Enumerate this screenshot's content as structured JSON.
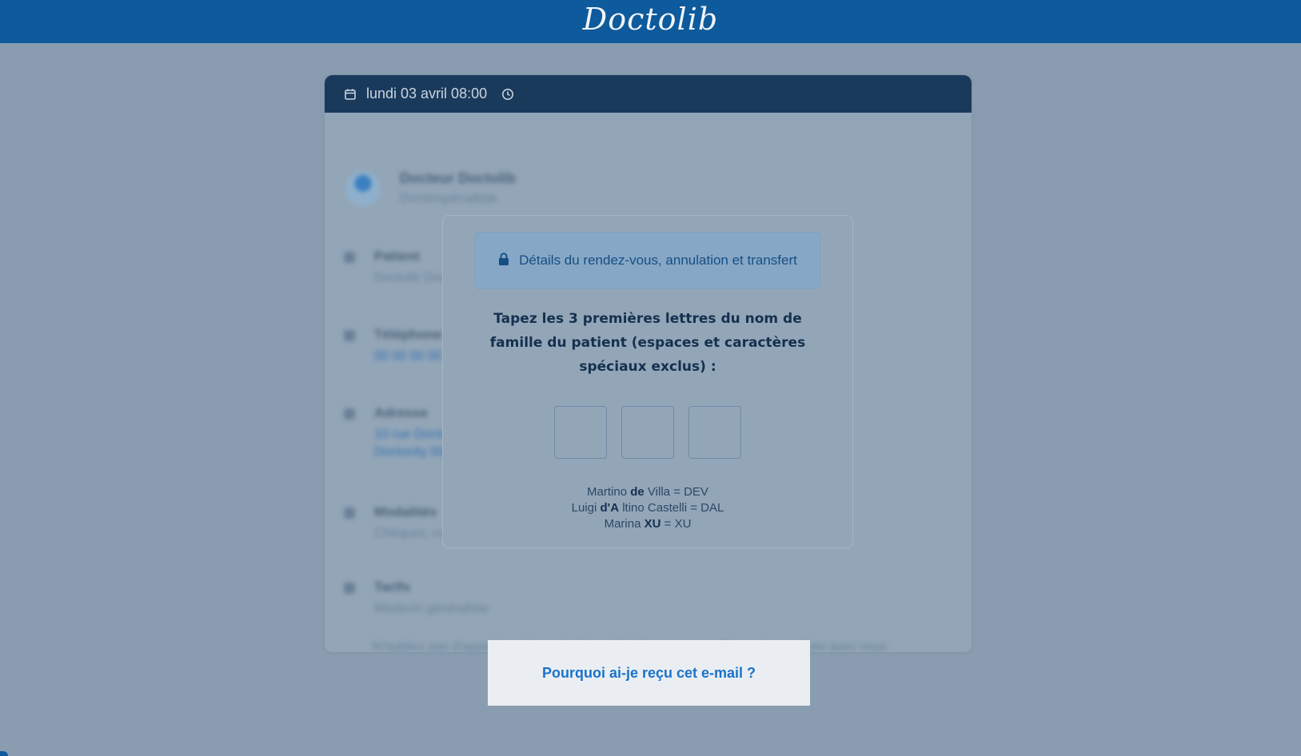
{
  "header": {
    "logo_text": "Doctolib"
  },
  "appointment": {
    "date_time": "lundi 03 avril 08:00"
  },
  "blurred_background": {
    "doctor_name": "Docteur Doctolib",
    "doctor_specialty": "Doctorspécialiste",
    "rows": [
      {
        "label": "Patient",
        "value": "Doctolib Doctolib"
      },
      {
        "label": "Téléphone",
        "value": "00 00 00 00 00"
      },
      {
        "label": "Adresse",
        "value": "10 rue Doctolib",
        "value2": "Doctocity 00000"
      },
      {
        "label": "Modalités",
        "value": "Chèques, carte bancaire"
      },
      {
        "label": "Tarifs",
        "value": "Médecin généraliste"
      }
    ],
    "footnote": "N'oubliez pas d'apporter votre carte de santé et toute preuve d'assurance privée avec vous"
  },
  "modal": {
    "banner": "Détails du rendez-vous, annulation et transfert",
    "instruction": "Tapez les 3 premières lettres du nom de famille du patient (espaces et caractères spéciaux exclus) :",
    "inputs": [
      "",
      "",
      ""
    ],
    "examples": [
      {
        "before": "Martino ",
        "bold": "de",
        "after": " Villa = DEV"
      },
      {
        "before": "Luigi ",
        "bold": "d'A",
        "after": " ltino Castelli = DAL"
      },
      {
        "before": "Marina ",
        "bold": "XU",
        "after": " = XU"
      }
    ]
  },
  "footer": {
    "why_link": "Pourquoi ai-je reçu cet e-mail ?"
  },
  "colors": {
    "brand": "#0d5a9c",
    "card_header": "#1a3a5c",
    "link": "#1a73c8"
  }
}
